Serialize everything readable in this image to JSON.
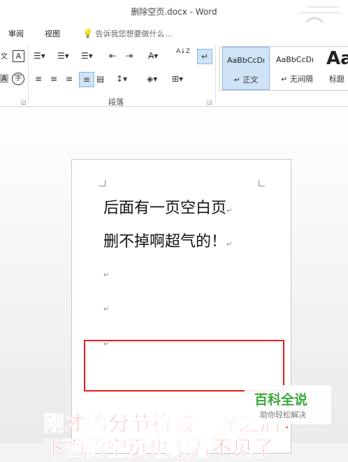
{
  "window": {
    "title": "删除空页.docx - Word"
  },
  "menu": {
    "review": "审阅",
    "view": "视图",
    "tell_me": "告诉我您想要做什么..."
  },
  "ribbon": {
    "paragraph_group_label": "段落",
    "pinyin_icon_text": "文",
    "char_border_icon_text": "A",
    "enclose_icon_text": "字",
    "shading_icon_text": "A",
    "sort_icon_text": "A↓Z"
  },
  "styles": [
    {
      "sample": "AaBbCcDı",
      "name": "↵ 正文"
    },
    {
      "sample": "AaBbCcDı",
      "name": "↵ 无间隔"
    },
    {
      "sample": "Aa",
      "name": "标题"
    }
  ],
  "document": {
    "lines": [
      "后面有一页空白页",
      "删不掉啊超气的！"
    ],
    "paragraph_mark": "↵"
  },
  "overlay": {
    "caption_line1": "刚才的分节符被删除之后，",
    "caption_line2": "下面的空页也跟着不见了",
    "watermark_title": "百科全说",
    "watermark_sub": "助你轻松解决"
  }
}
